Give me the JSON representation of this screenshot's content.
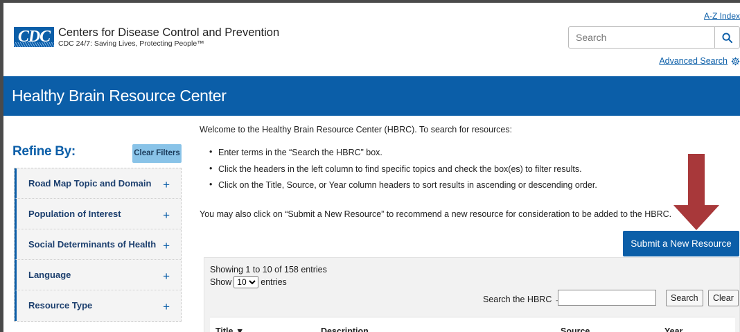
{
  "header": {
    "logo_mark": "CDC",
    "org_name": "Centers for Disease Control and Prevention",
    "tagline": "CDC 24/7: Saving Lives, Protecting People™",
    "az_index": "A-Z Index",
    "search_placeholder": "Search",
    "advanced_search": "Advanced Search"
  },
  "title_bar": {
    "title": "Healthy Brain Resource Center"
  },
  "sidebar": {
    "heading": "Refine By:",
    "clear_filters": "Clear Filters",
    "facets": [
      {
        "label": "Road Map Topic and Domain",
        "toggle": "+"
      },
      {
        "label": "Population of Interest",
        "toggle": "+"
      },
      {
        "label": "Social Determinants of Health",
        "toggle": "+"
      },
      {
        "label": "Language",
        "toggle": "+"
      },
      {
        "label": "Resource Type",
        "toggle": "+"
      }
    ]
  },
  "main": {
    "welcome": "Welcome to the Healthy Brain Resource Center (HBRC). To search for resources:",
    "bullets": [
      "Enter terms in the “Search the HBRC” box.",
      "Click the headers in the left column to find specific topics and check the box(es) to filter results.",
      "Click on the Title, Source, or Year column headers to sort results in ascending or descending order."
    ],
    "also": "You may also click on “Submit a New Resource” to recommend a new resource for consideration to be added to the HBRC.",
    "submit_button": "Submit a New Resource"
  },
  "table_controls": {
    "showing": "Showing 1 to 10 of 158 entries",
    "show_prefix": "Show",
    "page_size": "10",
    "show_suffix": "entries",
    "search_label": "Search the HBRC →",
    "search_button": "Search",
    "clear_button": "Clear"
  },
  "table": {
    "columns": [
      "Title ▼",
      "Description",
      "Source",
      "Year"
    ]
  },
  "colors": {
    "brand_blue": "#0b5ea8",
    "clear_filters_bg": "#89c3e8",
    "arrow": "#a8383a"
  },
  "icons": {
    "search": "search-icon",
    "settings": "gear-icon",
    "annotation": "down-arrow-icon"
  }
}
